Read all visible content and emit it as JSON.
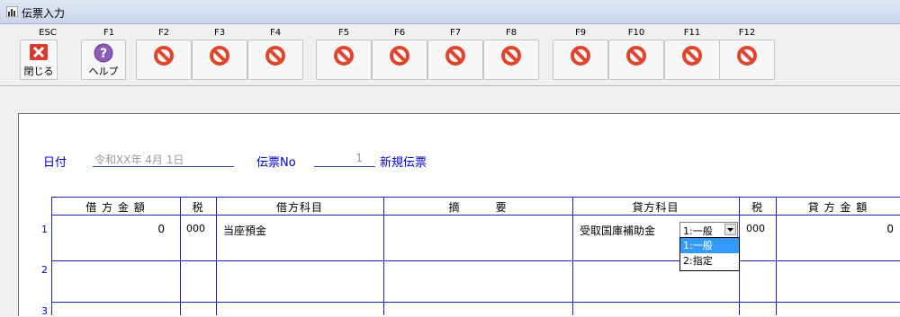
{
  "window": {
    "title": "伝票入力"
  },
  "fkeys": [
    {
      "key": "ESC",
      "caption": "閉じる",
      "icon": "close-x-icon"
    },
    {
      "key": "F1",
      "caption": "ヘルプ",
      "icon": "help-icon"
    },
    {
      "key": "F2",
      "caption": "",
      "icon": "disabled-icon"
    },
    {
      "key": "F3",
      "caption": "",
      "icon": "disabled-icon"
    },
    {
      "key": "F4",
      "caption": "",
      "icon": "disabled-icon"
    },
    {
      "key": "F5",
      "caption": "",
      "icon": "disabled-icon"
    },
    {
      "key": "F6",
      "caption": "",
      "icon": "disabled-icon"
    },
    {
      "key": "F7",
      "caption": "",
      "icon": "disabled-icon"
    },
    {
      "key": "F8",
      "caption": "",
      "icon": "disabled-icon"
    },
    {
      "key": "F9",
      "caption": "",
      "icon": "disabled-icon"
    },
    {
      "key": "F10",
      "caption": "",
      "icon": "disabled-icon"
    },
    {
      "key": "F11",
      "caption": "",
      "icon": "disabled-icon"
    },
    {
      "key": "F12",
      "caption": "",
      "icon": "disabled-icon"
    }
  ],
  "header": {
    "date_label": "日付",
    "date_value": "令和XX年 4月 1日",
    "slip_no_label": "伝票No",
    "slip_no_value": "1",
    "status": "新規伝票"
  },
  "table": {
    "columns": {
      "debit_amount": "借 方 金 額",
      "debit_tax": "税",
      "debit_account": "借方科目",
      "description": "摘　　　要",
      "credit_account": "貸方科目",
      "credit_tax": "税",
      "credit_amount": "貸 方 金 額"
    },
    "rows": [
      {
        "no": "1",
        "debit_amount": "0",
        "debit_tax": "000",
        "debit_account": "当座預金",
        "description": "",
        "credit_account": "受取国庫補助金",
        "credit_tax": "000",
        "credit_amount": "0"
      },
      {
        "no": "2"
      },
      {
        "no": "3"
      }
    ]
  },
  "combo": {
    "value": "1:一般",
    "options": [
      "1:一般",
      "2:指定"
    ],
    "selected_index": 0
  },
  "colors": {
    "link_blue": "#0000cc",
    "grid_line": "#2222aa",
    "selection": "#3399ff"
  }
}
